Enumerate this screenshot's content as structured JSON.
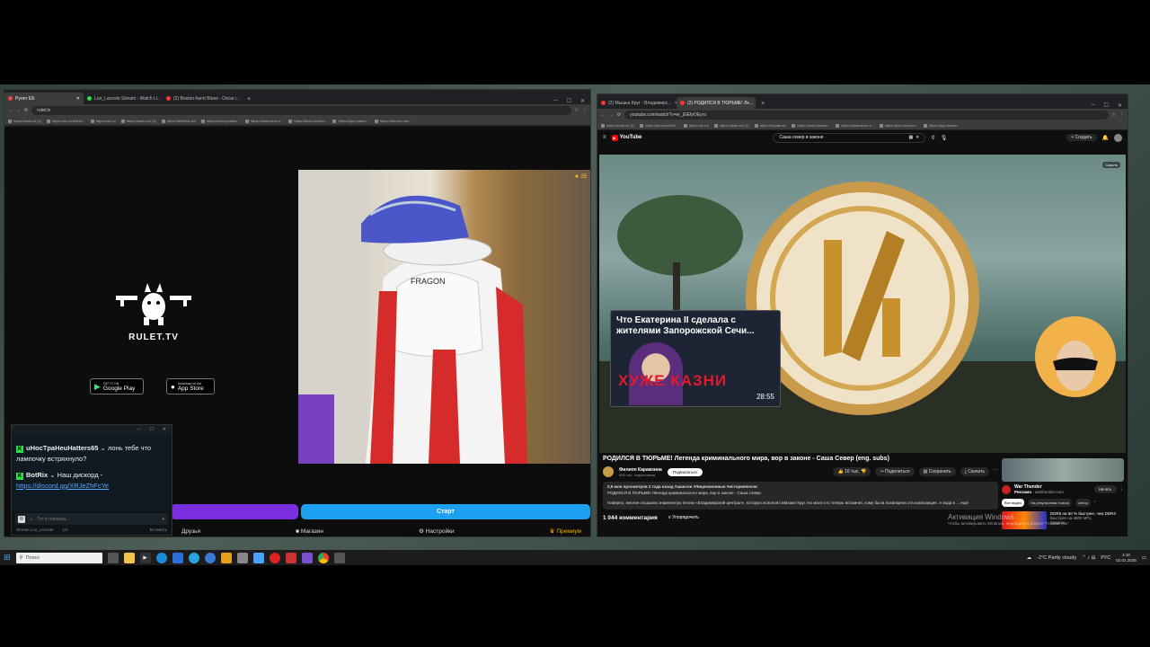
{
  "left_browser": {
    "tabs": [
      {
        "label": "Рулет ЕБ",
        "color": "#e44"
      },
      {
        "label": "Loo_Lacoste Stream - Watch Li...",
        "color": "#2fdc4a"
      },
      {
        "label": "(2) Boston-hurst Blues - Oscar i...",
        "color": "#f33"
      }
    ],
    "url": "rulet.tv",
    "bookmarks": [
      "https://mail.ru/ (1)",
      "https://vk.com/id18...",
      "https://ok.ru/",
      "https://lamb.su/ (1)",
      "https://betblick.su/",
      "https://www.youtub...",
      "https://www.lcmu.s...",
      "https://kick.com/lco...",
      "https://app.rutstro...",
      "https://sferrno.me/..."
    ]
  },
  "rulet": {
    "logo_text": "RULET.TV",
    "google_play_small": "GET IT ON",
    "google_play": "Google Play",
    "app_store_small": "Download on the",
    "app_store": "App Store",
    "video_badge": "25",
    "start_button": "Старт",
    "nav": {
      "friends": "Друзья",
      "shop": "Магазин",
      "settings": "Настройки",
      "premium": "Премиум"
    }
  },
  "chat": {
    "messages": [
      {
        "user": "uHocTpaHeuHatters65",
        "text": "лонь тебе что лампочку встряхнуло?"
      },
      {
        "user": "BotRix",
        "text": "Наш дискорд -",
        "link": "https://discord.gg/XRJeZhFcYe"
      }
    ],
    "input_placeholder": "Тут в плевака...",
    "footer_channel": "Stream Loo_Lacoste",
    "footer_count": "1/1",
    "footer_right": "Вставить"
  },
  "right_browser": {
    "tabs": [
      {
        "label": "(2) Мышка Круг - Владимирс...",
        "color": "#f33"
      },
      {
        "label": "(2) РОДИЛСЯ В ТЮРЬМЕ! Ле...",
        "color": "#f33"
      }
    ],
    "url": "youtube.com/watch?v=er_jGEfyOEyro",
    "bookmarks": [
      "https://mail.ru/ (1)",
      "https://vk.com/id18...",
      "https://ok.ru/",
      "https://lamb.su/ (1)",
      "https://tnoabl.su/",
      "https://www.youtub...",
      "https://www.lcmu.s...",
      "https://kick.com/loo...",
      "https://app.rutstro..."
    ]
  },
  "youtube": {
    "logo": "YouTube",
    "search_value": "Саша север в законе",
    "create_label": "Создать",
    "video_title": "РОДИЛСЯ В ТЮРЬМЕ! Легенда криминального мира, вор в законе - Саша Север (eng. subs)",
    "channel": "Филипп Карамзина",
    "subscribers": "626 тыс. подписчиков",
    "subscribe": "Подписаться",
    "likes": "16 тыс.",
    "share": "Поделиться",
    "save": "Сохранить",
    "download": "Скачать",
    "views_line": "2,5 млн просмотров  2 года назад  #шансон  #Лицензионные  #историяпесни",
    "desc_line1": "РОДИЛСЯ В ТЮРЬМЕ! Легенда криминального мира, вор в законе - Саша Север",
    "desc_line2": "Наверно, многие слышали знаменитую песню «Владимирский централ», которую исполнял Михаил Круг. Но мало кто теперь вспомнит, кому была посвящена эта композиция. А вода в ... ещё",
    "comments_count": "1 044 комментария",
    "sort_label": "Упорядочить",
    "overlay_title": "Что Екатерина II сделала с жителями Запорожской Сечи...",
    "overlay_big": "ХУЖЕ КАЗНИ",
    "overlay_time": "28:55",
    "top_badge": "Скрыть",
    "ad_title": "War Thunder",
    "ad_sub_label": "Реклама",
    "ad_sub": "warthunder.com",
    "ad_button": "Начать",
    "chip_all": "Все видео",
    "chip_related": "На результатам поиска",
    "chip_authors": "Автор",
    "side2_title": "DDR5 на 50 % быстрее, чем DDR4",
    "side2_sub": "Быстрее на 4800 МГц",
    "side2_brand": "Ударгон",
    "activation_title": "Активация Windows",
    "activation_sub": "Чтобы активировать Windows, перейдите в раздел \"Параметры\"."
  },
  "taskbar": {
    "search_placeholder": "Поиск",
    "weather": "-2°C  Partly cloudy",
    "lang": "РУС",
    "time": "2:10",
    "date": "02.01.2025"
  },
  "colors": {
    "rulet_start": "#1ea0f0",
    "rulet_purple": "#7b2ee0",
    "kick_green": "#2fdc4a",
    "youtube_red": "#ff0000"
  }
}
